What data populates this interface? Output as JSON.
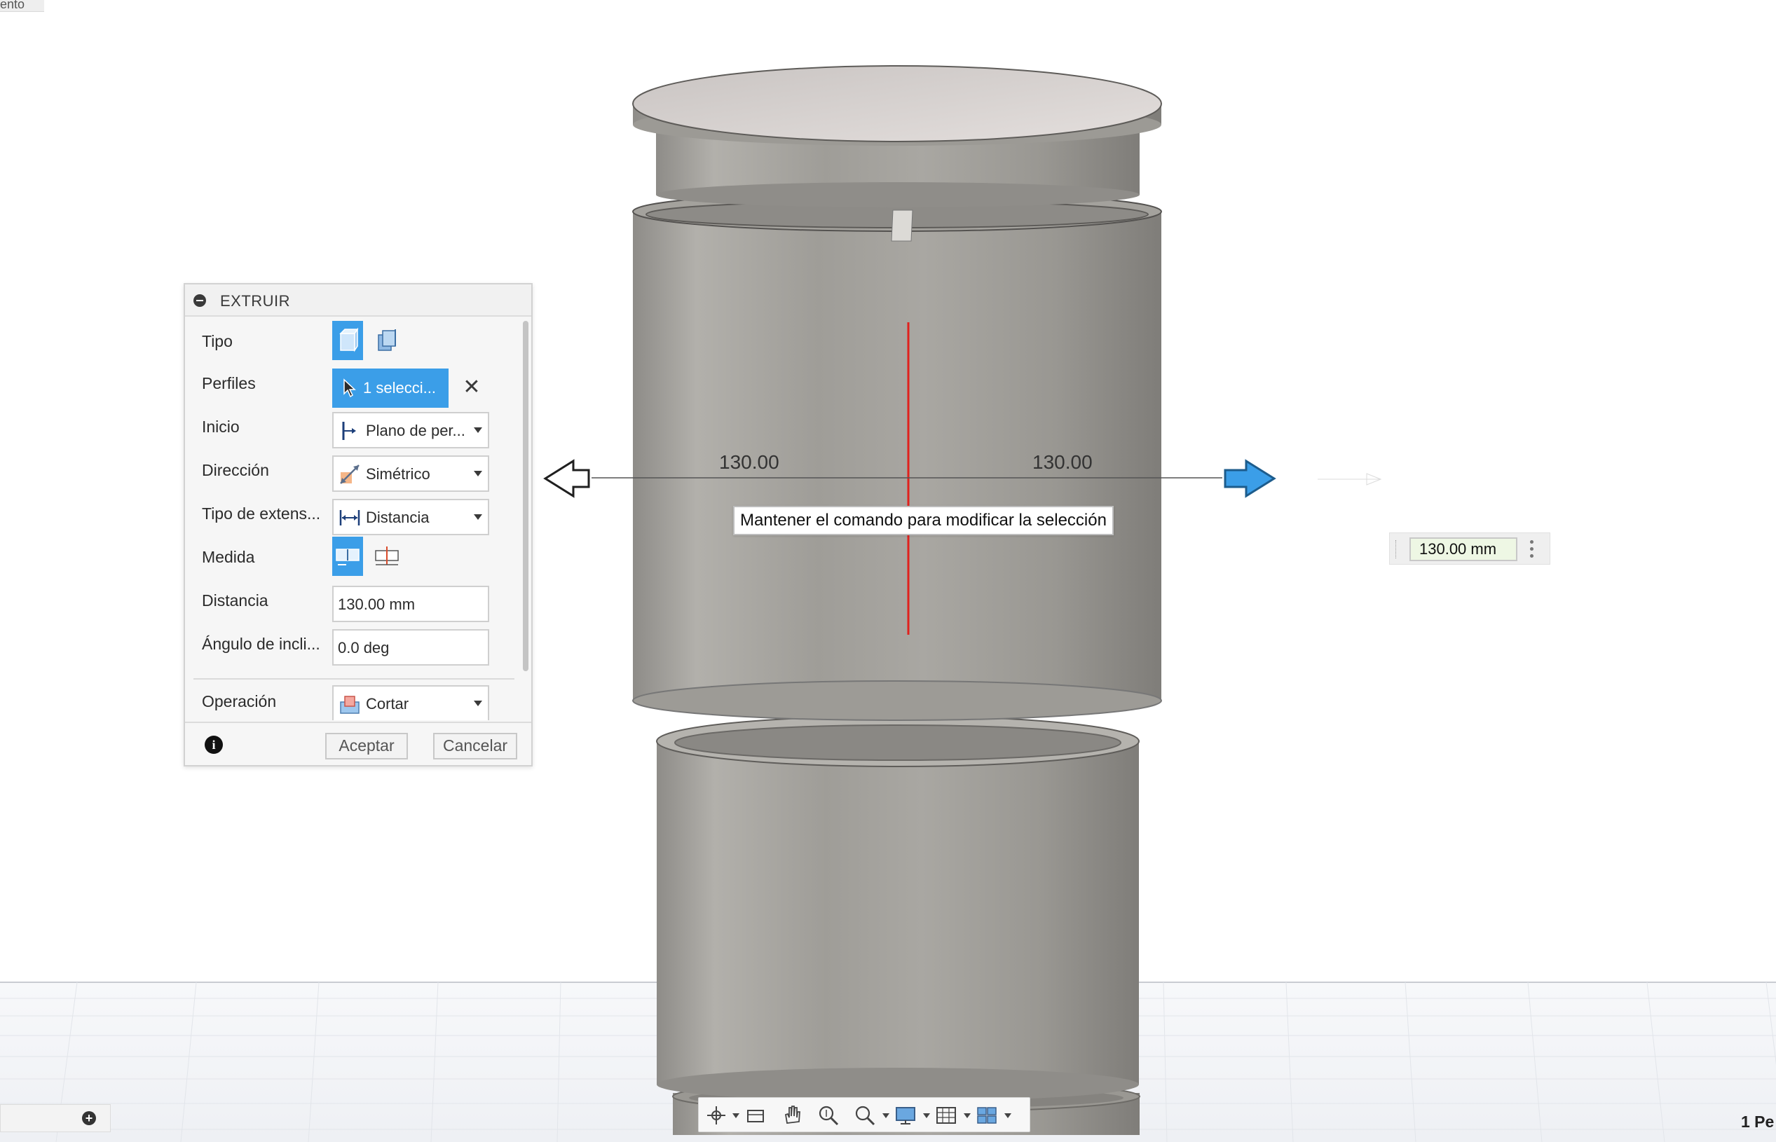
{
  "top_left_fragment": "ento",
  "dialog": {
    "title": "EXTRUIR",
    "rows": {
      "tipo": {
        "label": "Tipo"
      },
      "perfiles": {
        "label": "Perfiles",
        "value": "1 selecci..."
      },
      "inicio": {
        "label": "Inicio",
        "value": "Plano de per..."
      },
      "direccion": {
        "label": "Dirección",
        "value": "Simétrico"
      },
      "tipo_extension": {
        "label": "Tipo de extens...",
        "value": "Distancia"
      },
      "medida": {
        "label": "Medida"
      },
      "distancia": {
        "label": "Distancia",
        "value": "130.00 mm"
      },
      "angulo": {
        "label": "Ángulo de incli...",
        "value": "0.0 deg"
      },
      "operacion": {
        "label": "Operación",
        "value": "Cortar"
      }
    },
    "buttons": {
      "ok": "Aceptar",
      "cancel": "Cancelar"
    }
  },
  "viewport": {
    "dim_left": "130.00",
    "dim_right": "130.00",
    "tooltip": "Mantener el comando para modificar la selección",
    "distance_input": "130.00 mm",
    "bottom_right_fragment": "1 Pe"
  },
  "colors": {
    "accent": "#3b9ee8",
    "body_gray": "#a3a19c",
    "sketch_line": "#e0211d"
  },
  "icons": {
    "nav_toolbar": [
      "orbit-icon",
      "look-at-icon",
      "pan-icon",
      "zoom-icon",
      "fit-icon",
      "display-settings-icon",
      "grid-icon",
      "viewports-icon"
    ]
  }
}
